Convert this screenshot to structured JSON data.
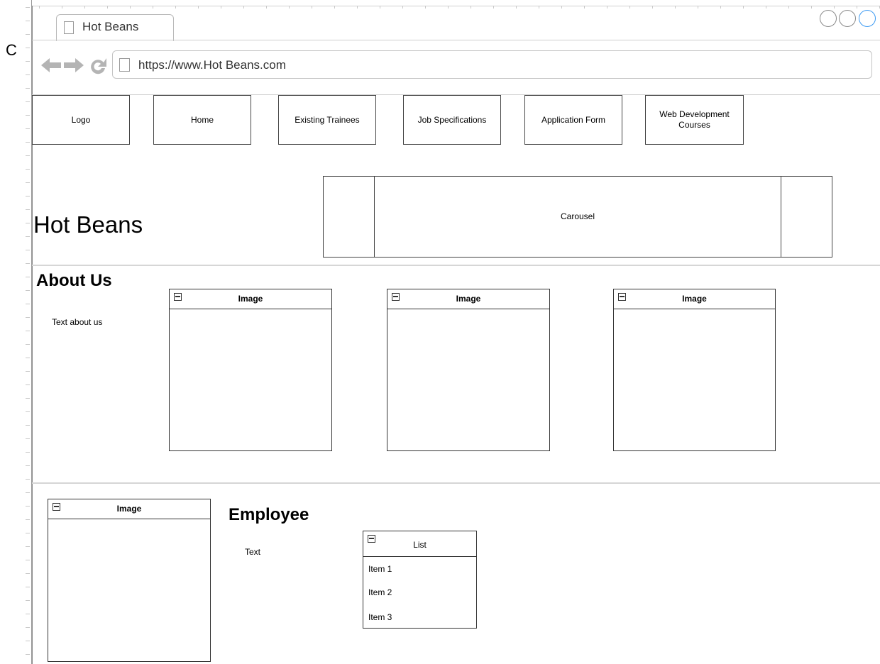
{
  "corner_letter": "C",
  "browser": {
    "tab_title": "Hot Beans",
    "url": "https://www.Hot Beans.com",
    "nav_icons": [
      "back-arrow-icon",
      "forward-arrow-icon",
      "reload-icon"
    ],
    "window_controls": [
      "circle-icon",
      "circle-icon",
      "circle-icon"
    ],
    "active_control_color": "#3e9bf2"
  },
  "nav": {
    "logo": "Logo",
    "home": "Home",
    "existing_trainees": "Existing Trainees",
    "job_specifications": "Job Specifications",
    "application_form": "Application Form",
    "web_dev_courses": "Web Development Courses"
  },
  "hero": {
    "title": "Hot Beans",
    "carousel_label": "Carousel"
  },
  "about": {
    "heading": "About Us",
    "text": "Text about us",
    "images": [
      {
        "title": "Image"
      },
      {
        "title": "Image"
      },
      {
        "title": "Image"
      }
    ]
  },
  "employee": {
    "image_title": "Image",
    "heading": "Employee",
    "text": "Text",
    "list": {
      "title": "List",
      "items": [
        "Item 1",
        "Item 2",
        "Item 3"
      ]
    }
  }
}
